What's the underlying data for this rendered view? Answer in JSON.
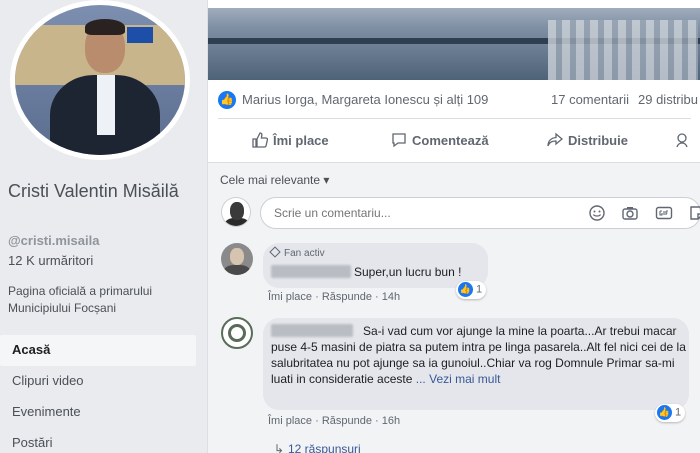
{
  "profile": {
    "name": "Cristi Valentin Misăilă",
    "username": "@cristi.misaila",
    "followers": "12 K urmăritori",
    "description": "Pagina oficială a primarului Municipiului Focșani",
    "nav": [
      {
        "label": "Acasă",
        "active": true
      },
      {
        "label": "Clipuri video",
        "active": false
      },
      {
        "label": "Evenimente",
        "active": false
      },
      {
        "label": "Postări",
        "active": false
      }
    ]
  },
  "post": {
    "likers": "Marius Iorga, Margareta Ionescu și alți 109",
    "comments_count": "17 comentarii",
    "shares_count": "29 distribu",
    "actions": {
      "like": "Îmi place",
      "comment": "Comentează",
      "share": "Distribuie"
    }
  },
  "comments_section": {
    "sort_label": "Cele mai relevante ▾",
    "input_placeholder": "Scrie un comentariu...",
    "comments": [
      {
        "badge": "Fan activ",
        "text": "Super,un lucru bun !",
        "reactions": "1",
        "like_label": "Îmi place",
        "reply_label": "Răspunde",
        "time": "14h"
      },
      {
        "text_first": "Sa-i vad cum vor ajunge la mine la poarta...Ar",
        "text_rest": "trebui macar puse 4-5 masini de piatra sa putem intra pe linga pasarela..Alt fel nici cei de la salubritatea nu pot ajunge sa ia gunoiul..Chiar va rog Domnule Primar sa-mi luati in consideratie aceste",
        "see_more": "... Vezi mai mult",
        "reactions": "1",
        "like_label": "Îmi place",
        "reply_label": "Răspunde",
        "time": "16h",
        "replies": "12 răspunsuri"
      }
    ]
  },
  "colors": {
    "facebook_blue": "#1877f2",
    "link_blue": "#385898",
    "background": "#e9ebee"
  }
}
